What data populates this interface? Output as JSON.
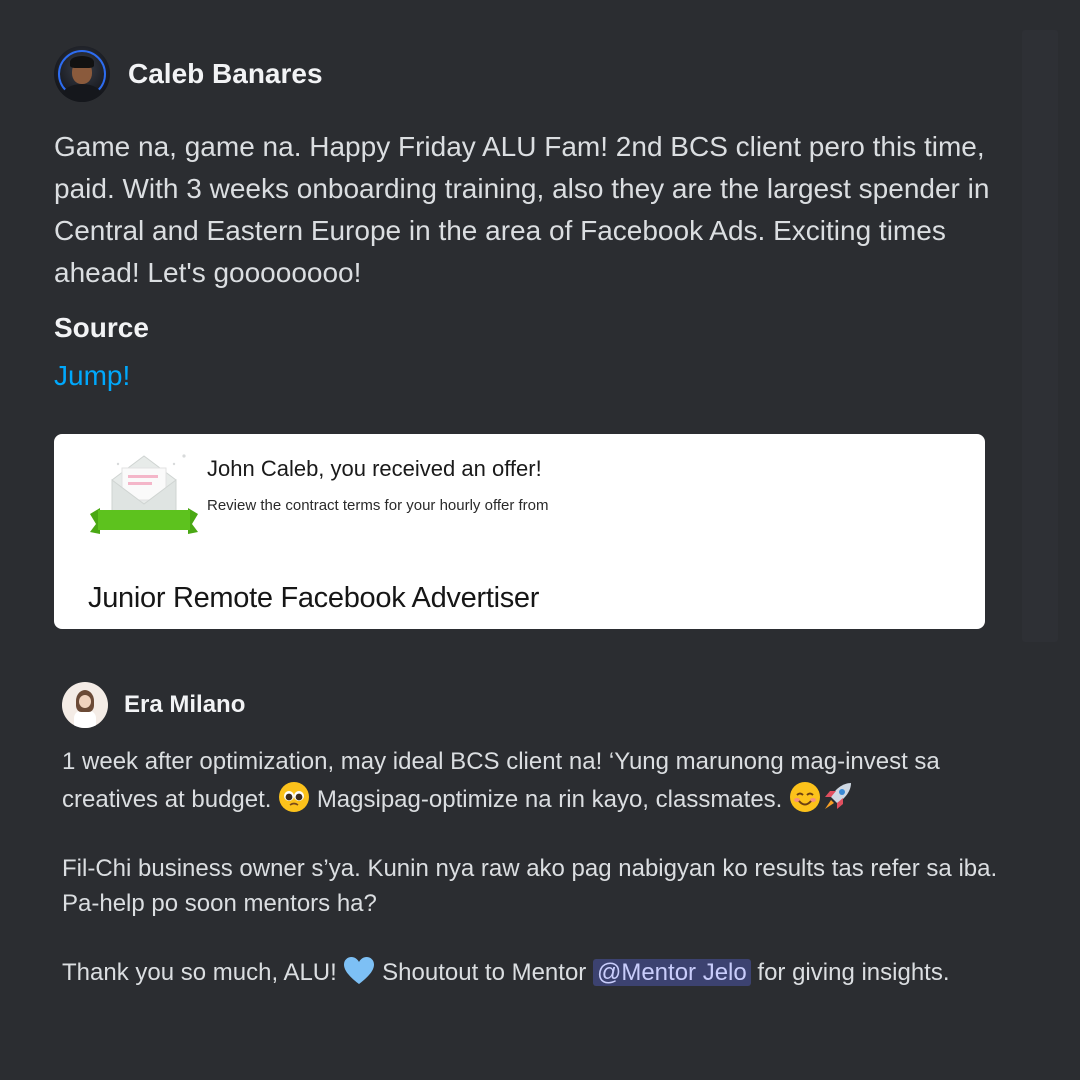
{
  "messages": [
    {
      "author": "Caleb Banares",
      "body": "Game na, game na. Happy Friday ALU Fam! 2nd BCS client pero this time, paid. With 3 weeks onboarding training, also they are the largest spender in Central and Eastern Europe in the area of Facebook Ads. Exciting times ahead! Let's goooooooo!",
      "source_label": "Source",
      "link_label": "Jump!",
      "attachment": {
        "title": "John Caleb, you received an offer!",
        "subtitle": "Review the contract terms for your hourly offer from",
        "job_title": "Junior Remote Facebook Advertiser"
      }
    },
    {
      "author": "Era Milano",
      "para1_a": "1 week after optimization, may ideal BCS client na! ‘Yung marunong mag-invest sa creatives at budget.",
      "para1_b": "Magsipag-optimize na rin kayo, classmates.",
      "para2": "Fil-Chi business owner s’ya. Kunin nya raw ako pag nabigyan ko results tas refer sa iba. Pa-help po soon mentors ha?",
      "para3_a": "Thank you so much, ALU!",
      "para3_b": "Shoutout to Mentor",
      "mention": "@Mentor Jelo",
      "para3_c": "for giving insights.",
      "emojis": [
        "pleading-face-emoji",
        "smiling-face-emoji",
        "rocket-emoji",
        "light-blue-heart-emoji"
      ]
    }
  ],
  "colors": {
    "background": "#2b2d31",
    "link": "#00a8fc",
    "mention_bg": "#3c4270",
    "mention_text": "#c9cdfb",
    "card_bg": "#ffffff",
    "ribbon": "#5dc21e"
  }
}
